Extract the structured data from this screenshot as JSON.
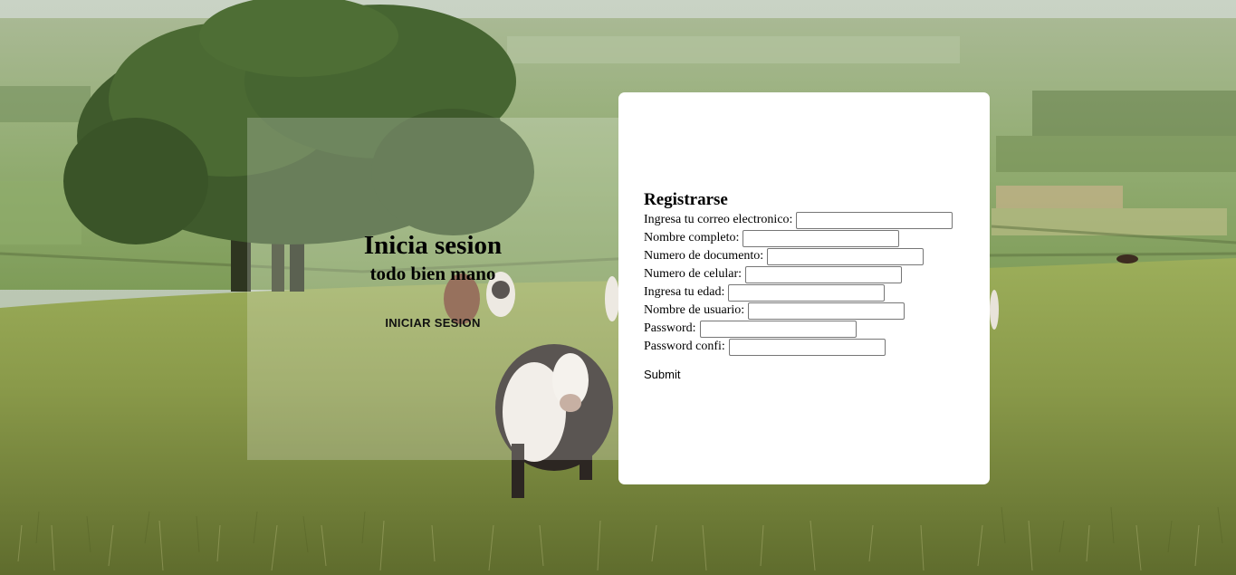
{
  "welcome": {
    "title": "Inicia sesion",
    "subtitle": "todo bien mano",
    "login_button_label": "INICIAR SESION"
  },
  "register": {
    "title": "Registrarse",
    "fields": [
      {
        "label": "Ingresa tu correo electronico:",
        "value": ""
      },
      {
        "label": "Nombre completo:",
        "value": ""
      },
      {
        "label": "Numero de documento:",
        "value": ""
      },
      {
        "label": "Numero de celular:",
        "value": ""
      },
      {
        "label": "Ingresa tu edad:",
        "value": ""
      },
      {
        "label": "Nombre de usuario:",
        "value": ""
      },
      {
        "label": "Password:",
        "value": ""
      },
      {
        "label": "Password confi:",
        "value": ""
      }
    ],
    "submit_label": "Submit"
  },
  "colors": {
    "card_background": "#ffffff",
    "panel_overlay": "rgba(255,255,255,0.22)"
  }
}
